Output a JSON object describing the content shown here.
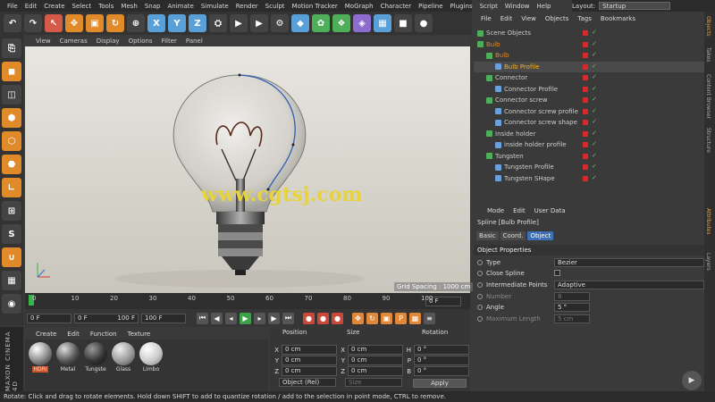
{
  "menu": [
    "File",
    "Edit",
    "Create",
    "Select",
    "Tools",
    "Mesh",
    "Snap",
    "Animate",
    "Simulate",
    "Render",
    "Sculpt",
    "Motion Tracker",
    "MoGraph",
    "Character",
    "Pipeline",
    "Plugins",
    "Script",
    "Window",
    "Help"
  ],
  "layout": {
    "label": "Layout:",
    "value": "Startup"
  },
  "toolbar_axes": [
    "X",
    "Y",
    "Z"
  ],
  "viewport_menu": [
    "View",
    "Cameras",
    "Display",
    "Options",
    "Filter",
    "Panel"
  ],
  "watermark": "www.cgtsj.com",
  "grid_spacing": "Grid Spacing : 1000 cm",
  "timeline_ticks": [
    "0",
    "10",
    "20",
    "30",
    "40",
    "50",
    "60",
    "70",
    "80",
    "90",
    "100"
  ],
  "timeline_current": "0 F",
  "transport": {
    "start": "0 F",
    "range_start": "0 F",
    "range_end": "100 F",
    "end": "100 F"
  },
  "materials_menu": [
    "Create",
    "Edit",
    "Function",
    "Texture"
  ],
  "materials": [
    "HDRI",
    "Metal",
    "Tungste",
    "Glass",
    "Limbo"
  ],
  "maxon_text": "MAXON CINEMA 4D",
  "coords": {
    "headers": {
      "position": "Position",
      "size": "Size",
      "rotation": "Rotation"
    },
    "rows": [
      {
        "pa": "X",
        "pv": "0 cm",
        "sa": "X",
        "sv": "0 cm",
        "ra": "H",
        "rv": "0 °"
      },
      {
        "pa": "Y",
        "pv": "0 cm",
        "sa": "Y",
        "sv": "0 cm",
        "ra": "P",
        "rv": "0 °"
      },
      {
        "pa": "Z",
        "pv": "0 cm",
        "sa": "Z",
        "sv": "0 cm",
        "ra": "B",
        "rv": "0 °"
      }
    ],
    "mode": "Object (Rel)",
    "size_mode": "Size",
    "apply": "Apply"
  },
  "status": "Rotate: Click and drag to rotate elements. Hold down SHIFT to add to quantize rotation / add to the selection in point mode, CTRL to remove.",
  "objects_menu": [
    "File",
    "Edit",
    "View",
    "Objects",
    "Tags",
    "Bookmarks"
  ],
  "objects": [
    {
      "name": "Scene Objects",
      "indent": 0,
      "color": "#ccc"
    },
    {
      "name": "Bulb",
      "indent": 0,
      "color": "#e08a2a"
    },
    {
      "name": "Bulb",
      "indent": 1,
      "color": "#e08a2a"
    },
    {
      "name": "Bulb Profile",
      "indent": 2,
      "color": "#f0b030"
    },
    {
      "name": "Connector",
      "indent": 1,
      "color": "#ccc"
    },
    {
      "name": "Connector Profile",
      "indent": 2,
      "color": "#ccc"
    },
    {
      "name": "Connector screw",
      "indent": 1,
      "color": "#ccc"
    },
    {
      "name": "Connector screw profile",
      "indent": 2,
      "color": "#ccc"
    },
    {
      "name": "Connector screw shape",
      "indent": 2,
      "color": "#ccc"
    },
    {
      "name": "Inside holder",
      "indent": 1,
      "color": "#ccc"
    },
    {
      "name": "inside holder profile",
      "indent": 2,
      "color": "#ccc"
    },
    {
      "name": "Tungsten",
      "indent": 1,
      "color": "#ccc"
    },
    {
      "name": "Tungsten Profile",
      "indent": 2,
      "color": "#ccc"
    },
    {
      "name": "Tungsten SHape",
      "indent": 2,
      "color": "#ccc"
    }
  ],
  "side_tabs": [
    "Objects",
    "Takes",
    "Content Browser",
    "Structure",
    "Attributes",
    "Layers"
  ],
  "attr_menu": [
    "Mode",
    "Edit",
    "User Data"
  ],
  "attr_title": "Spline [Bulb Profile]",
  "attr_tabs": [
    "Basic",
    "Coord.",
    "Object"
  ],
  "attr_section": "Object Properties",
  "props": [
    {
      "label": "Type",
      "value": "Bezier",
      "dim": false
    },
    {
      "label": "Close Spline",
      "value": "",
      "dim": false
    },
    {
      "label": "Intermediate Points",
      "value": "Adaptive",
      "dim": false
    },
    {
      "label": "Number",
      "value": "8",
      "dim": true
    },
    {
      "label": "Angle",
      "value": "5 °",
      "dim": false
    },
    {
      "label": "Maximum Length",
      "value": "5 cm",
      "dim": true
    }
  ]
}
